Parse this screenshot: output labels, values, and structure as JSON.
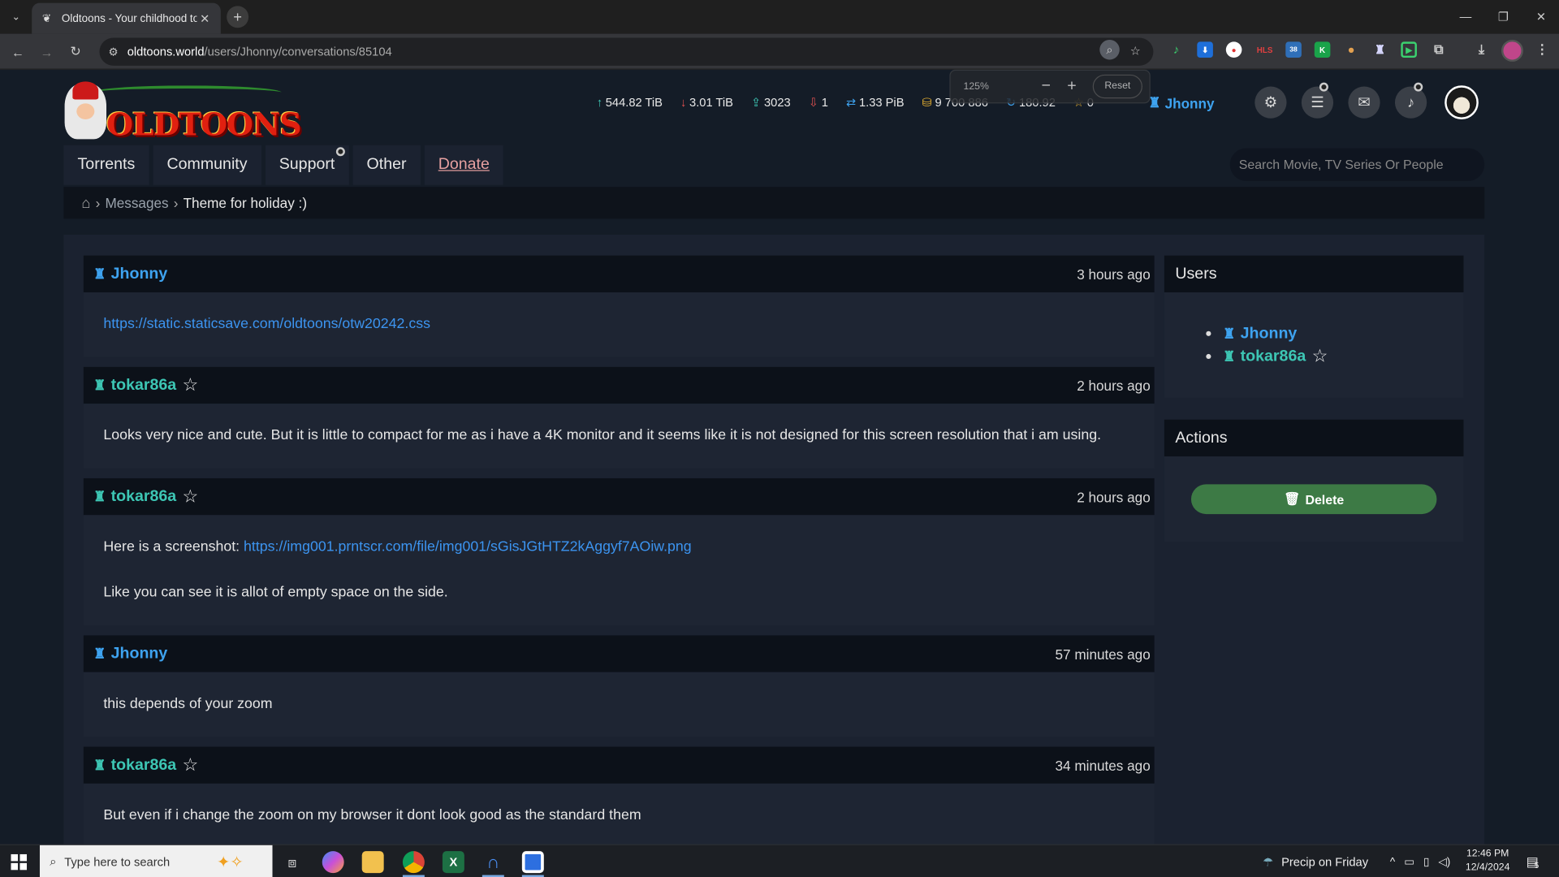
{
  "browser": {
    "tab_title": "Oldtoons - Your childhood toons",
    "url_host": "oldtoons.world",
    "url_path": "/users/Jhonny/conversations/85104",
    "zoom_label": "125%",
    "zoom_reset": "Reset",
    "ext_hls": "HLS",
    "ext_badge": "38"
  },
  "site": {
    "logo_text": "OLDTOONS",
    "stats": {
      "upload": "544.82 TiB",
      "download": "3.01 TiB",
      "seeding": "3023",
      "leeching": "1",
      "buffer": "1.33 PiB",
      "bonus": "9 700 886",
      "ratio": "180.92",
      "tokens": "0"
    },
    "header_user": "Jhonny",
    "nav": [
      "Torrents",
      "Community",
      "Support",
      "Other",
      "Donate"
    ],
    "search_placeholder": "Search Movie, TV Series Or People"
  },
  "breadcrumb": {
    "messages": "Messages",
    "current": "Theme for holiday :)"
  },
  "messages": [
    {
      "user": "Jhonny",
      "time": "3 hours ago",
      "link": "https://static.staticsave.com/oldtoons/otw20242.css"
    },
    {
      "user": "tokar86a",
      "time": "2 hours ago",
      "text": "Looks very nice and cute. But it is little to compact for me as i have a 4K monitor and it seems like it is not designed for this screen resolution that i am using."
    },
    {
      "user": "tokar86a",
      "time": "2 hours ago",
      "text_prefix": "Here is a screenshot:",
      "link": "https://img001.prntscr.com/file/img001/sGisJGtHTZ2kAggyf7AOiw.png",
      "text2": "Like you can see it is allot of empty space on the side."
    },
    {
      "user": "Jhonny",
      "time": "57 minutes ago",
      "text": "this depends of your zoom"
    },
    {
      "user": "tokar86a",
      "time": "34 minutes ago",
      "text": "But even if i change the zoom on my browser it dont look good as the standard them"
    }
  ],
  "sidebar": {
    "users_title": "Users",
    "users": [
      "Jhonny",
      "tokar86a"
    ],
    "actions_title": "Actions",
    "delete_label": "Delete"
  },
  "taskbar": {
    "search_placeholder": "Type here to search",
    "weather": "Precip on Friday",
    "time": "12:46 PM",
    "date": "12/4/2024",
    "notif_count": "5"
  },
  "colors": {
    "page_bg": "#141c27",
    "user_jhonny": "#3ea3f0",
    "user_tokar": "#3dc6b4",
    "link": "#3c94f0",
    "delete_button": "#3d7a45"
  }
}
